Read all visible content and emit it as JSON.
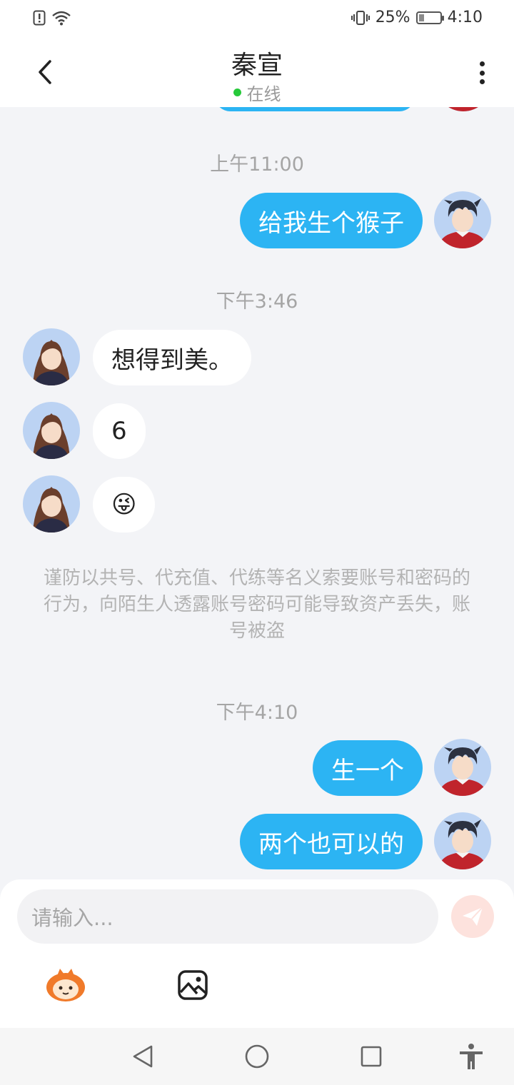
{
  "status_bar": {
    "battery_percent": "25%",
    "time": "4:10",
    "battery_level": 0.25,
    "icons": [
      "alert-icon",
      "wifi-icon",
      "vibrate-icon",
      "battery-icon"
    ]
  },
  "header": {
    "title": "秦宣",
    "status": "在线",
    "status_color": "#26c93a"
  },
  "messages": [
    {
      "type": "time",
      "text": "上午11:00"
    },
    {
      "type": "out",
      "text": "给我生个猴子"
    },
    {
      "type": "time",
      "text": "下午3:46"
    },
    {
      "type": "in",
      "text": "想得到美。"
    },
    {
      "type": "in",
      "text": "6"
    },
    {
      "type": "in",
      "text": "😜"
    },
    {
      "type": "notice",
      "text": "谨防以共号、代充值、代练等名义索要账号和密码的行为，向陌生人透露账号密码可能导致资产丢失，账号被盗"
    },
    {
      "type": "time",
      "text": "下午4:10"
    },
    {
      "type": "out",
      "text": "生一个"
    },
    {
      "type": "out",
      "text": "两个也可以的"
    }
  ],
  "input": {
    "placeholder": "请输入..."
  },
  "toolbar": {
    "tools": [
      "mascot-sticker-icon",
      "image-icon"
    ]
  },
  "colors": {
    "outgoing_bubble": "#2cb4f3",
    "incoming_bubble": "#ffffff",
    "background": "#f3f4f7",
    "send_button": "#fde2dd"
  }
}
